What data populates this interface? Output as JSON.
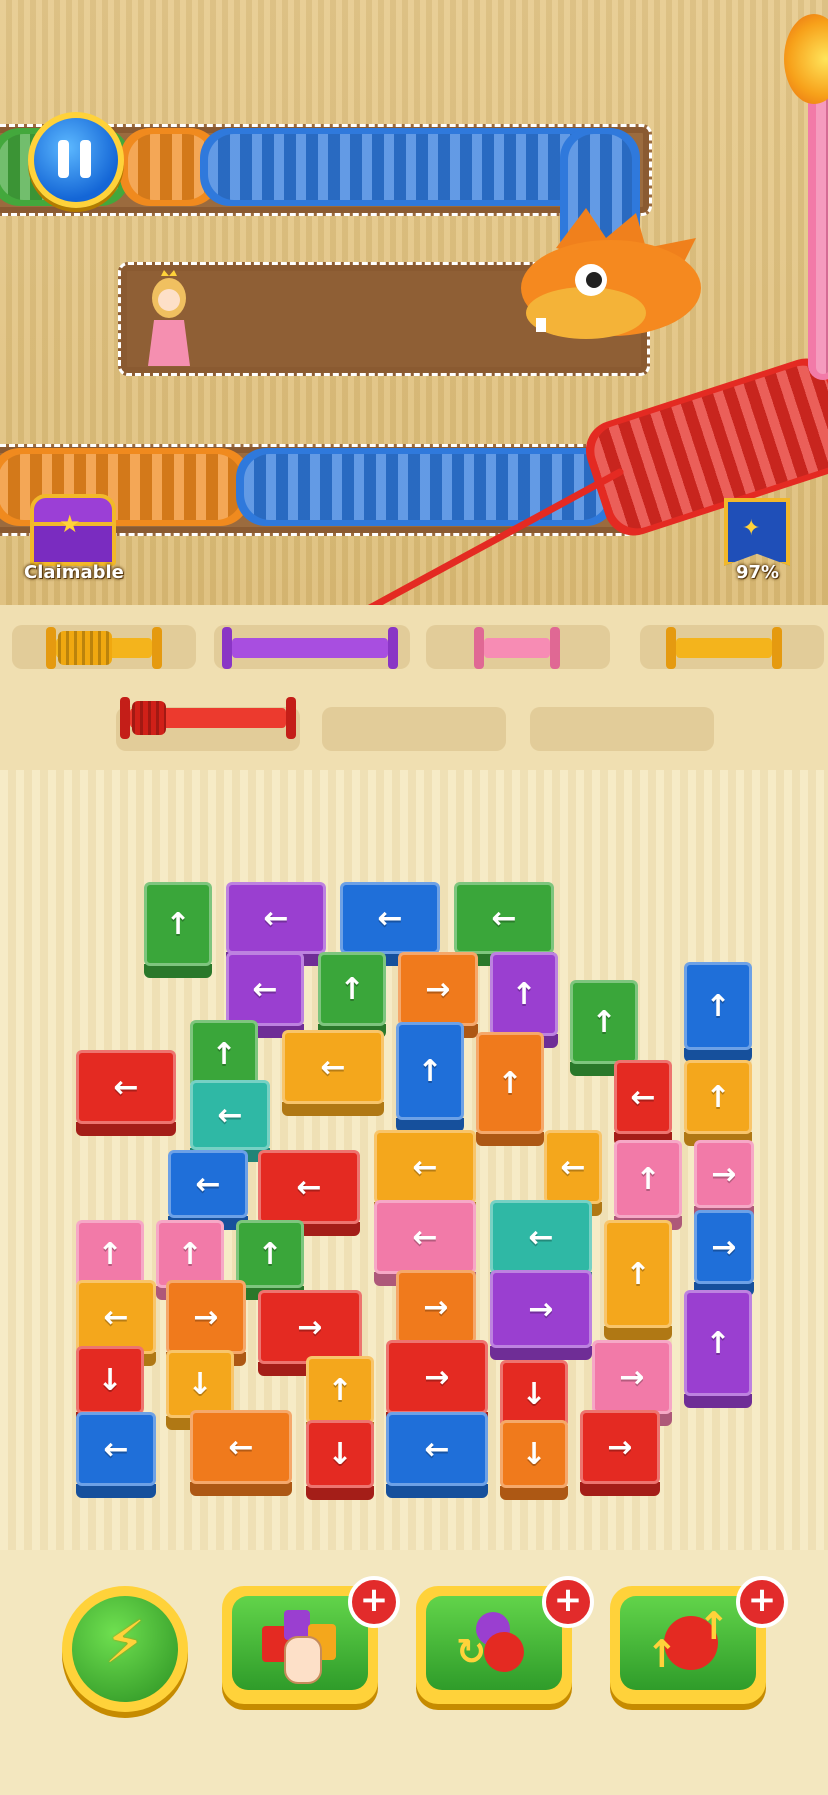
{
  "hud": {
    "chest_label": "Claimable",
    "progress_label": "97%",
    "pause_icon": "pause-icon",
    "chest_icon": "treasure-chest-icon",
    "flag_icon": "dragon-flag-icon"
  },
  "colors": {
    "green": "#3aa63a",
    "purple": "#9a3fd0",
    "blue": "#1f6fd9",
    "orange": "#f07a1c",
    "red": "#e42a22",
    "yellow": "#f4a71c",
    "teal": "#2fb8a5",
    "pink": "#f27aa8"
  },
  "spools": [
    {
      "color": "yellow",
      "state": "filled"
    },
    {
      "color": "purple",
      "state": "empty"
    },
    {
      "color": "pink",
      "state": "empty"
    },
    {
      "color": "yellow",
      "state": "empty"
    },
    {
      "color": "red",
      "state": "filling"
    }
  ],
  "boosters": [
    {
      "name": "lightning-booster",
      "icon": "lightning-icon"
    },
    {
      "name": "pick-block-booster",
      "icon": "hand-tap-icon",
      "badge": "+"
    },
    {
      "name": "shuffle-booster",
      "icon": "shuffle-yarn-icon",
      "badge": "+"
    },
    {
      "name": "upgrade-yarn-booster",
      "icon": "yarn-arrow-up-icon",
      "badge": "+"
    }
  ],
  "arrows": {
    "up": "↑",
    "down": "↓",
    "left": "←",
    "right": "→"
  }
}
